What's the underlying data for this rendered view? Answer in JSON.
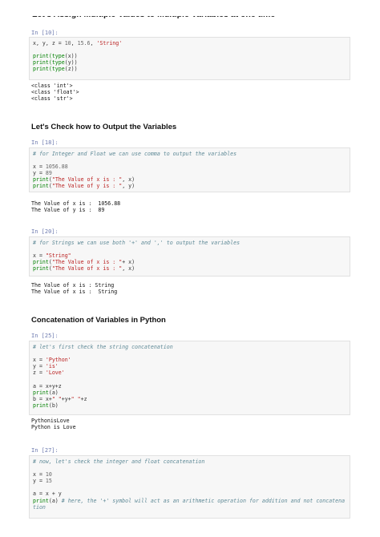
{
  "page_heading_cut": "Let's Assign Multiple Values to Multiple Variables at one time",
  "cells": [
    {
      "prompt": "In [10]:",
      "lines": [
        [
          {
            "t": "x, y, z = ",
            "c": "kw"
          },
          {
            "t": "10",
            "c": "num"
          },
          {
            "t": ", ",
            "c": "kw"
          },
          {
            "t": "15.6",
            "c": "num"
          },
          {
            "t": ", ",
            "c": "kw"
          },
          {
            "t": "'String'",
            "c": "str"
          }
        ],
        [],
        [
          {
            "t": "print",
            "c": "builtin"
          },
          {
            "t": "(type",
            "c": "builtin"
          },
          {
            "t": "(x))",
            "c": "kw"
          }
        ],
        [
          {
            "t": "print",
            "c": "builtin"
          },
          {
            "t": "(type",
            "c": "builtin"
          },
          {
            "t": "(y))",
            "c": "kw"
          }
        ],
        [
          {
            "t": "print",
            "c": "builtin"
          },
          {
            "t": "(type",
            "c": "builtin"
          },
          {
            "t": "(z))",
            "c": "kw"
          }
        ]
      ],
      "output": [
        "<class 'int'>",
        "<class 'float'>",
        "<class 'str'>"
      ]
    },
    {
      "heading": "Let's Check how to Output the Variables",
      "prompt": "In [18]:",
      "lines": [
        [
          {
            "t": "# for Integer and Float we can use comma to output the variables",
            "c": "comment"
          }
        ],
        [],
        [
          {
            "t": "x = ",
            "c": "kw"
          },
          {
            "t": "1056.88",
            "c": "num"
          }
        ],
        [
          {
            "t": "y = ",
            "c": "kw"
          },
          {
            "t": "89",
            "c": "num"
          }
        ],
        [
          {
            "t": "print",
            "c": "builtin"
          },
          {
            "t": "(",
            "c": "kw"
          },
          {
            "t": "\"The Value of x is : \"",
            "c": "str"
          },
          {
            "t": ", x)",
            "c": "kw"
          }
        ],
        [
          {
            "t": "print",
            "c": "builtin"
          },
          {
            "t": "(",
            "c": "kw"
          },
          {
            "t": "\"The Value of y is : \"",
            "c": "str"
          },
          {
            "t": ", y)",
            "c": "kw"
          }
        ]
      ],
      "output": [
        "The Value of x is :  1056.88",
        "The Value of y is :  89"
      ]
    },
    {
      "prompt": "In [20]:",
      "lines": [
        [
          {
            "t": "# for Strings we can use both '+' and ',' to output the variables",
            "c": "comment"
          }
        ],
        [],
        [
          {
            "t": "x = ",
            "c": "kw"
          },
          {
            "t": "\"String\"",
            "c": "str"
          }
        ],
        [
          {
            "t": "print",
            "c": "builtin"
          },
          {
            "t": "(",
            "c": "kw"
          },
          {
            "t": "\"The Value of x is : \"",
            "c": "str"
          },
          {
            "t": "+ x)",
            "c": "kw"
          }
        ],
        [
          {
            "t": "print",
            "c": "builtin"
          },
          {
            "t": "(",
            "c": "kw"
          },
          {
            "t": "\"The Value of x is : \"",
            "c": "str"
          },
          {
            "t": ", x)",
            "c": "kw"
          }
        ]
      ],
      "output": [
        "The Value of x is : String",
        "The Value of x is :  String"
      ]
    },
    {
      "heading": "Concatenation of Variables in Python",
      "prompt": "In [25]:",
      "lines": [
        [
          {
            "t": "# let's first check the string concatenation",
            "c": "comment"
          }
        ],
        [],
        [
          {
            "t": "x = ",
            "c": "kw"
          },
          {
            "t": "'Python'",
            "c": "str"
          }
        ],
        [
          {
            "t": "y = ",
            "c": "kw"
          },
          {
            "t": "'is'",
            "c": "str"
          }
        ],
        [
          {
            "t": "z = ",
            "c": "kw"
          },
          {
            "t": "'Love'",
            "c": "str"
          }
        ],
        [],
        [
          {
            "t": "a = x+y+z",
            "c": "kw"
          }
        ],
        [
          {
            "t": "print",
            "c": "builtin"
          },
          {
            "t": "(a)",
            "c": "kw"
          }
        ],
        [
          {
            "t": "b = x+",
            "c": "kw"
          },
          {
            "t": "\" \"",
            "c": "str"
          },
          {
            "t": "+y+",
            "c": "kw"
          },
          {
            "t": "\" \"",
            "c": "str"
          },
          {
            "t": "+z",
            "c": "kw"
          }
        ],
        [
          {
            "t": "print",
            "c": "builtin"
          },
          {
            "t": "(b)",
            "c": "kw"
          }
        ]
      ],
      "output": [
        "PythonisLove",
        "Python is Love"
      ]
    },
    {
      "prompt": "In [27]:",
      "lines": [
        [
          {
            "t": "# now, let's check the integer and float concatenation",
            "c": "comment"
          }
        ],
        [],
        [
          {
            "t": "x = ",
            "c": "kw"
          },
          {
            "t": "10",
            "c": "num"
          }
        ],
        [
          {
            "t": "y = ",
            "c": "kw"
          },
          {
            "t": "15",
            "c": "num"
          }
        ],
        [],
        [
          {
            "t": "a = x + y",
            "c": "kw"
          }
        ],
        [
          {
            "t": "print",
            "c": "builtin"
          },
          {
            "t": "(a) ",
            "c": "kw"
          },
          {
            "t": "# here, the '+' symbol will act as an arithmetic operation for addition and not concatena",
            "c": "comment"
          }
        ],
        [
          {
            "t": "tion",
            "c": "comment"
          }
        ]
      ],
      "output": []
    }
  ]
}
